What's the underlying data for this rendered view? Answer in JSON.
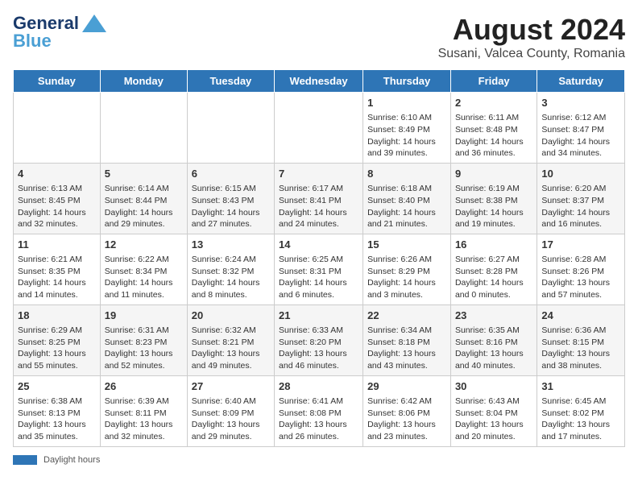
{
  "logo": {
    "line1": "General",
    "line2": "Blue"
  },
  "title": "August 2024",
  "subtitle": "Susani, Valcea County, Romania",
  "days_of_week": [
    "Sunday",
    "Monday",
    "Tuesday",
    "Wednesday",
    "Thursday",
    "Friday",
    "Saturday"
  ],
  "footer": {
    "bar_label": "Daylight hours"
  },
  "weeks": [
    [
      {
        "day": "",
        "data": ""
      },
      {
        "day": "",
        "data": ""
      },
      {
        "day": "",
        "data": ""
      },
      {
        "day": "",
        "data": ""
      },
      {
        "day": "1",
        "data": "Sunrise: 6:10 AM\nSunset: 8:49 PM\nDaylight: 14 hours and 39 minutes."
      },
      {
        "day": "2",
        "data": "Sunrise: 6:11 AM\nSunset: 8:48 PM\nDaylight: 14 hours and 36 minutes."
      },
      {
        "day": "3",
        "data": "Sunrise: 6:12 AM\nSunset: 8:47 PM\nDaylight: 14 hours and 34 minutes."
      }
    ],
    [
      {
        "day": "4",
        "data": "Sunrise: 6:13 AM\nSunset: 8:45 PM\nDaylight: 14 hours and 32 minutes."
      },
      {
        "day": "5",
        "data": "Sunrise: 6:14 AM\nSunset: 8:44 PM\nDaylight: 14 hours and 29 minutes."
      },
      {
        "day": "6",
        "data": "Sunrise: 6:15 AM\nSunset: 8:43 PM\nDaylight: 14 hours and 27 minutes."
      },
      {
        "day": "7",
        "data": "Sunrise: 6:17 AM\nSunset: 8:41 PM\nDaylight: 14 hours and 24 minutes."
      },
      {
        "day": "8",
        "data": "Sunrise: 6:18 AM\nSunset: 8:40 PM\nDaylight: 14 hours and 21 minutes."
      },
      {
        "day": "9",
        "data": "Sunrise: 6:19 AM\nSunset: 8:38 PM\nDaylight: 14 hours and 19 minutes."
      },
      {
        "day": "10",
        "data": "Sunrise: 6:20 AM\nSunset: 8:37 PM\nDaylight: 14 hours and 16 minutes."
      }
    ],
    [
      {
        "day": "11",
        "data": "Sunrise: 6:21 AM\nSunset: 8:35 PM\nDaylight: 14 hours and 14 minutes."
      },
      {
        "day": "12",
        "data": "Sunrise: 6:22 AM\nSunset: 8:34 PM\nDaylight: 14 hours and 11 minutes."
      },
      {
        "day": "13",
        "data": "Sunrise: 6:24 AM\nSunset: 8:32 PM\nDaylight: 14 hours and 8 minutes."
      },
      {
        "day": "14",
        "data": "Sunrise: 6:25 AM\nSunset: 8:31 PM\nDaylight: 14 hours and 6 minutes."
      },
      {
        "day": "15",
        "data": "Sunrise: 6:26 AM\nSunset: 8:29 PM\nDaylight: 14 hours and 3 minutes."
      },
      {
        "day": "16",
        "data": "Sunrise: 6:27 AM\nSunset: 8:28 PM\nDaylight: 14 hours and 0 minutes."
      },
      {
        "day": "17",
        "data": "Sunrise: 6:28 AM\nSunset: 8:26 PM\nDaylight: 13 hours and 57 minutes."
      }
    ],
    [
      {
        "day": "18",
        "data": "Sunrise: 6:29 AM\nSunset: 8:25 PM\nDaylight: 13 hours and 55 minutes."
      },
      {
        "day": "19",
        "data": "Sunrise: 6:31 AM\nSunset: 8:23 PM\nDaylight: 13 hours and 52 minutes."
      },
      {
        "day": "20",
        "data": "Sunrise: 6:32 AM\nSunset: 8:21 PM\nDaylight: 13 hours and 49 minutes."
      },
      {
        "day": "21",
        "data": "Sunrise: 6:33 AM\nSunset: 8:20 PM\nDaylight: 13 hours and 46 minutes."
      },
      {
        "day": "22",
        "data": "Sunrise: 6:34 AM\nSunset: 8:18 PM\nDaylight: 13 hours and 43 minutes."
      },
      {
        "day": "23",
        "data": "Sunrise: 6:35 AM\nSunset: 8:16 PM\nDaylight: 13 hours and 40 minutes."
      },
      {
        "day": "24",
        "data": "Sunrise: 6:36 AM\nSunset: 8:15 PM\nDaylight: 13 hours and 38 minutes."
      }
    ],
    [
      {
        "day": "25",
        "data": "Sunrise: 6:38 AM\nSunset: 8:13 PM\nDaylight: 13 hours and 35 minutes."
      },
      {
        "day": "26",
        "data": "Sunrise: 6:39 AM\nSunset: 8:11 PM\nDaylight: 13 hours and 32 minutes."
      },
      {
        "day": "27",
        "data": "Sunrise: 6:40 AM\nSunset: 8:09 PM\nDaylight: 13 hours and 29 minutes."
      },
      {
        "day": "28",
        "data": "Sunrise: 6:41 AM\nSunset: 8:08 PM\nDaylight: 13 hours and 26 minutes."
      },
      {
        "day": "29",
        "data": "Sunrise: 6:42 AM\nSunset: 8:06 PM\nDaylight: 13 hours and 23 minutes."
      },
      {
        "day": "30",
        "data": "Sunrise: 6:43 AM\nSunset: 8:04 PM\nDaylight: 13 hours and 20 minutes."
      },
      {
        "day": "31",
        "data": "Sunrise: 6:45 AM\nSunset: 8:02 PM\nDaylight: 13 hours and 17 minutes."
      }
    ]
  ]
}
